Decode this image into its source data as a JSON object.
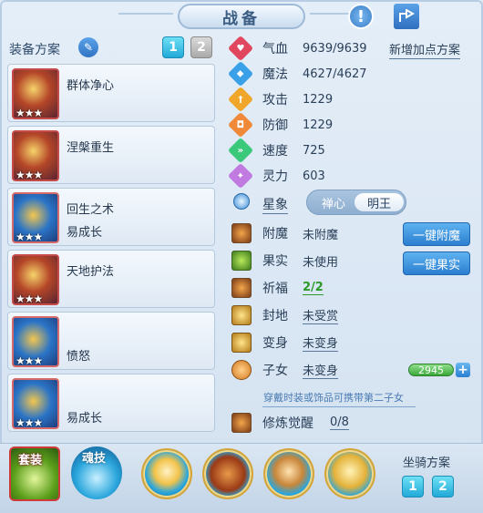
{
  "header": {
    "title": "战备",
    "info_icon": "exclamation-icon",
    "share_icon": "share-icon"
  },
  "plan": {
    "label": "装备方案",
    "edit_icon": "pencil-icon",
    "tabs": [
      "1",
      "2"
    ],
    "active_tab": "1"
  },
  "equipment": [
    {
      "name": "群体净心",
      "sub": "",
      "stars": "★★★"
    },
    {
      "name": "涅槃重生",
      "sub": "",
      "stars": "★★★"
    },
    {
      "name": "回生之术",
      "sub": "易成长",
      "stars": "★★★"
    },
    {
      "name": "天地护法",
      "sub": "",
      "stars": "★★★"
    },
    {
      "name": "",
      "sub": "愤怒",
      "stars": "★★★"
    },
    {
      "name": "",
      "sub": "易成长",
      "stars": "★★★"
    }
  ],
  "stats": {
    "add_plan": "新增加点方案",
    "items": [
      {
        "name": "气血",
        "value": "9639/9639",
        "icon": "heart-icon",
        "color": "#e0475f"
      },
      {
        "name": "魔法",
        "value": "4627/4627",
        "icon": "mana-icon",
        "color": "#3aa0e8"
      },
      {
        "name": "攻击",
        "value": "1229",
        "icon": "sword-icon",
        "color": "#f0a62a"
      },
      {
        "name": "防御",
        "value": "1229",
        "icon": "shield-icon",
        "color": "#f08a3a"
      },
      {
        "name": "速度",
        "value": "725",
        "icon": "speed-icon",
        "color": "#3ac87a"
      },
      {
        "name": "灵力",
        "value": "603",
        "icon": "spirit-icon",
        "color": "#c07ae0"
      }
    ]
  },
  "star_sign": {
    "label": "星象",
    "options": [
      "禅心",
      "明王"
    ],
    "selected": "明王"
  },
  "props": [
    {
      "name": "附魔",
      "value": "未附魔",
      "icon": "enchant-icon"
    },
    {
      "name": "果实",
      "value": "未使用",
      "icon": "fruit-icon"
    },
    {
      "name": "祈福",
      "value": "2/2",
      "icon": "blessing-icon"
    },
    {
      "name": "封地",
      "value": "未受赏",
      "icon": "fief-icon"
    },
    {
      "name": "变身",
      "value": "未变身",
      "icon": "transform-icon"
    },
    {
      "name": "子女",
      "value": "未变身",
      "icon": "child-icon"
    },
    {
      "name": "修炼觉醒",
      "value": "0/8",
      "icon": "awaken-icon"
    }
  ],
  "actions": {
    "enchant": "一键附魔",
    "fruit": "一键果实"
  },
  "child": {
    "points": "2945",
    "plus": "+",
    "hint": "穿戴时装或饰品可携带第二子女"
  },
  "bottom": {
    "suit": "套装",
    "soul": "魂技",
    "mount_label": "坐骑方案",
    "mount_tabs": [
      "1",
      "2"
    ],
    "skill_icons": [
      "skill-dancer-icon",
      "skill-scroll-icon",
      "skill-monk-icon",
      "skill-golden-icon"
    ]
  }
}
